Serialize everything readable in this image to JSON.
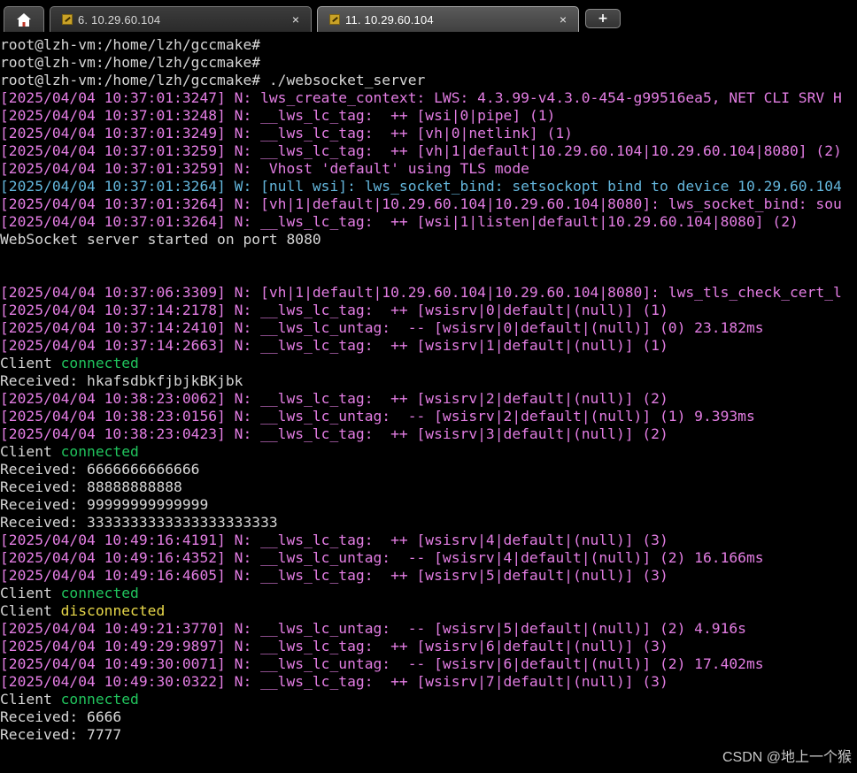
{
  "tabs": [
    {
      "kind": "home",
      "icon": "home-icon"
    },
    {
      "kind": "session",
      "icon": "terminal-session-icon",
      "label": "6. 10.29.60.104",
      "close": "×",
      "active": false
    },
    {
      "kind": "session",
      "icon": "terminal-session-icon",
      "label": "11. 10.29.60.104",
      "close": "×",
      "active": true
    },
    {
      "kind": "add",
      "icon": "plus-icon",
      "label": "+"
    }
  ],
  "terminal": {
    "lines": [
      {
        "segs": [
          {
            "t": "root@lzh-vm:/home/lzh/gccmake#",
            "c": "normal"
          }
        ]
      },
      {
        "segs": [
          {
            "t": "root@lzh-vm:/home/lzh/gccmake#",
            "c": "normal"
          }
        ]
      },
      {
        "segs": [
          {
            "t": "root@lzh-vm:/home/lzh/gccmake# ./websocket_server",
            "c": "normal"
          }
        ]
      },
      {
        "segs": [
          {
            "t": "[2025/04/04 10:37:01:3247] N: lws_create_context: LWS: 4.3.99-v4.3.0-454-g99516ea5, NET CLI SRV H",
            "c": "log"
          }
        ]
      },
      {
        "segs": [
          {
            "t": "[2025/04/04 10:37:01:3248] N: __lws_lc_tag:  ++ [wsi|0|pipe] (1)",
            "c": "log"
          }
        ]
      },
      {
        "segs": [
          {
            "t": "[2025/04/04 10:37:01:3249] N: __lws_lc_tag:  ++ [vh|0|netlink] (1)",
            "c": "log"
          }
        ]
      },
      {
        "segs": [
          {
            "t": "[2025/04/04 10:37:01:3259] N: __lws_lc_tag:  ++ [vh|1|default|10.29.60.104|10.29.60.104|8080] (2)",
            "c": "log"
          }
        ]
      },
      {
        "segs": [
          {
            "t": "[2025/04/04 10:37:01:3259] N:  Vhost 'default' using TLS mode",
            "c": "log"
          }
        ]
      },
      {
        "segs": [
          {
            "t": "[2025/04/04 10:37:01:3264] W: [null wsi]: lws_socket_bind: setsockopt bind to device 10.29.60.104",
            "c": "warn"
          }
        ]
      },
      {
        "segs": [
          {
            "t": "[2025/04/04 10:37:01:3264] N: [vh|1|default|10.29.60.104|10.29.60.104|8080]: lws_socket_bind: sou",
            "c": "log"
          }
        ]
      },
      {
        "segs": [
          {
            "t": "[2025/04/04 10:37:01:3264] N: __lws_lc_tag:  ++ [wsi|1|listen|default|10.29.60.104|8080] (2)",
            "c": "log"
          }
        ]
      },
      {
        "segs": [
          {
            "t": "WebSocket server started on port 8080",
            "c": "normal"
          }
        ]
      },
      {
        "segs": [
          {
            "t": "",
            "c": "normal"
          }
        ]
      },
      {
        "segs": [
          {
            "t": "",
            "c": "normal"
          }
        ]
      },
      {
        "segs": [
          {
            "t": "[2025/04/04 10:37:06:3309] N: [vh|1|default|10.29.60.104|10.29.60.104|8080]: lws_tls_check_cert_l",
            "c": "log"
          }
        ]
      },
      {
        "segs": [
          {
            "t": "[2025/04/04 10:37:14:2178] N: __lws_lc_tag:  ++ [wsisrv|0|default|(null)] (1)",
            "c": "log"
          }
        ]
      },
      {
        "segs": [
          {
            "t": "[2025/04/04 10:37:14:2410] N: __lws_lc_untag:  -- [wsisrv|0|default|(null)] (0) 23.182ms",
            "c": "log"
          }
        ]
      },
      {
        "segs": [
          {
            "t": "[2025/04/04 10:37:14:2663] N: __lws_lc_tag:  ++ [wsisrv|1|default|(null)] (1)",
            "c": "log"
          }
        ]
      },
      {
        "segs": [
          {
            "t": "Client ",
            "c": "normal"
          },
          {
            "t": "connected",
            "c": "green"
          }
        ]
      },
      {
        "segs": [
          {
            "t": "Received: hkafsdbkfjbjkBKjbk",
            "c": "normal"
          }
        ]
      },
      {
        "segs": [
          {
            "t": "[2025/04/04 10:38:23:0062] N: __lws_lc_tag:  ++ [wsisrv|2|default|(null)] (2)",
            "c": "log"
          }
        ]
      },
      {
        "segs": [
          {
            "t": "[2025/04/04 10:38:23:0156] N: __lws_lc_untag:  -- [wsisrv|2|default|(null)] (1) 9.393ms",
            "c": "log"
          }
        ]
      },
      {
        "segs": [
          {
            "t": "[2025/04/04 10:38:23:0423] N: __lws_lc_tag:  ++ [wsisrv|3|default|(null)] (2)",
            "c": "log"
          }
        ]
      },
      {
        "segs": [
          {
            "t": "Client ",
            "c": "normal"
          },
          {
            "t": "connected",
            "c": "green"
          }
        ]
      },
      {
        "segs": [
          {
            "t": "Received: 6666666666666",
            "c": "normal"
          }
        ]
      },
      {
        "segs": [
          {
            "t": "Received: 88888888888",
            "c": "normal"
          }
        ]
      },
      {
        "segs": [
          {
            "t": "Received: 99999999999999",
            "c": "normal"
          }
        ]
      },
      {
        "segs": [
          {
            "t": "Received: 3333333333333333333333",
            "c": "normal"
          }
        ]
      },
      {
        "segs": [
          {
            "t": "[2025/04/04 10:49:16:4191] N: __lws_lc_tag:  ++ [wsisrv|4|default|(null)] (3)",
            "c": "log"
          }
        ]
      },
      {
        "segs": [
          {
            "t": "[2025/04/04 10:49:16:4352] N: __lws_lc_untag:  -- [wsisrv|4|default|(null)] (2) 16.166ms",
            "c": "log"
          }
        ]
      },
      {
        "segs": [
          {
            "t": "[2025/04/04 10:49:16:4605] N: __lws_lc_tag:  ++ [wsisrv|5|default|(null)] (3)",
            "c": "log"
          }
        ]
      },
      {
        "segs": [
          {
            "t": "Client ",
            "c": "normal"
          },
          {
            "t": "connected",
            "c": "green"
          }
        ]
      },
      {
        "segs": [
          {
            "t": "Client ",
            "c": "normal"
          },
          {
            "t": "disconnected",
            "c": "yellow"
          }
        ]
      },
      {
        "segs": [
          {
            "t": "[2025/04/04 10:49:21:3770] N: __lws_lc_untag:  -- [wsisrv|5|default|(null)] (2) 4.916s",
            "c": "log"
          }
        ]
      },
      {
        "segs": [
          {
            "t": "[2025/04/04 10:49:29:9897] N: __lws_lc_tag:  ++ [wsisrv|6|default|(null)] (3)",
            "c": "log"
          }
        ]
      },
      {
        "segs": [
          {
            "t": "[2025/04/04 10:49:30:0071] N: __lws_lc_untag:  -- [wsisrv|6|default|(null)] (2) 17.402ms",
            "c": "log"
          }
        ]
      },
      {
        "segs": [
          {
            "t": "[2025/04/04 10:49:30:0322] N: __lws_lc_tag:  ++ [wsisrv|7|default|(null)] (3)",
            "c": "log"
          }
        ]
      },
      {
        "segs": [
          {
            "t": "Client ",
            "c": "normal"
          },
          {
            "t": "connected",
            "c": "green"
          }
        ]
      },
      {
        "segs": [
          {
            "t": "Received: 6666",
            "c": "normal"
          }
        ]
      },
      {
        "segs": [
          {
            "t": "Received: 7777",
            "c": "normal"
          }
        ]
      }
    ]
  },
  "colors": {
    "background": "#000000",
    "normal": "#d6d6d6",
    "log": "#e37de3",
    "warn": "#64b6dc",
    "green": "#21c45d",
    "yellow": "#e8d84a"
  },
  "watermark": "CSDN @地上一个猴"
}
